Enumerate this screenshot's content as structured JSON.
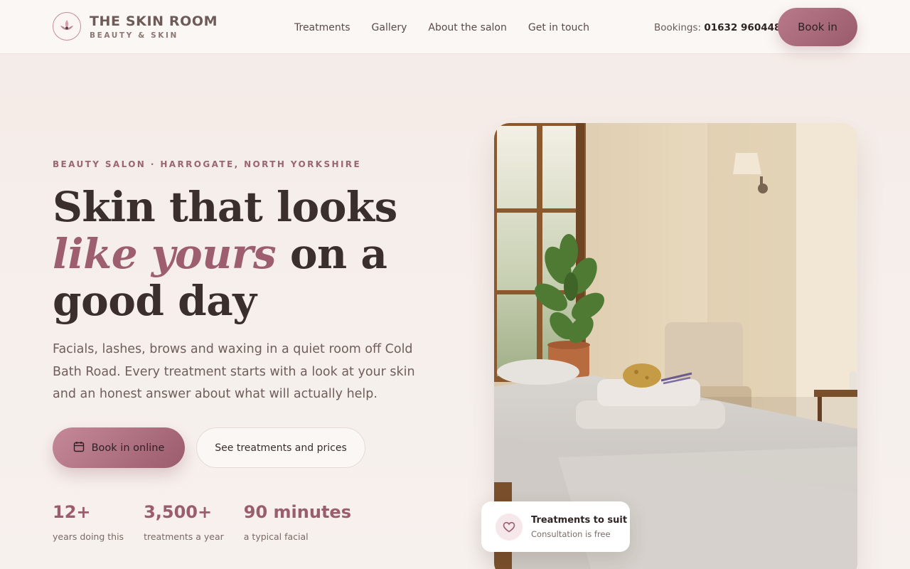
{
  "brand": {
    "name": "THE SKIN ROOM",
    "tagline": "BEAUTY & SKIN",
    "logo_icon": "lotus-icon"
  },
  "nav": {
    "items": [
      {
        "label": "Treatments"
      },
      {
        "label": "Gallery"
      },
      {
        "label": "About the salon"
      },
      {
        "label": "Get in touch"
      }
    ]
  },
  "header": {
    "bookings_label": "Bookings:",
    "bookings_phone": "01632 960448",
    "book_button": "Book in"
  },
  "hero": {
    "eyebrow": "BEAUTY SALON · HARROGATE, NORTH YORKSHIRE",
    "headline_part1": "Skin that looks ",
    "headline_emphasis": "like yours",
    "headline_part2": " on a good day",
    "lede": "Facials, lashes, brows and waxing in a quiet room off Cold Bath Road. Every treatment starts with a look at your skin and an honest answer about what will actually help.",
    "primary_cta": "Book in online",
    "primary_cta_icon": "calendar-icon",
    "secondary_cta": "See treatments and prices",
    "stats": [
      {
        "value": "12+",
        "label": "years doing this"
      },
      {
        "value": "3,500+",
        "label": "treatments a year"
      },
      {
        "value": "90 minutes",
        "label": "a typical facial"
      }
    ]
  },
  "badge": {
    "icon": "heart-icon",
    "title": "Treatments to suit",
    "subtitle": "Consultation is free"
  },
  "colors": {
    "accent": "#9d5f70",
    "accent_light": "#c48999",
    "background": "#f4ebe7",
    "header_bg": "#faf7f4",
    "text_dark": "#3b2f2d"
  }
}
